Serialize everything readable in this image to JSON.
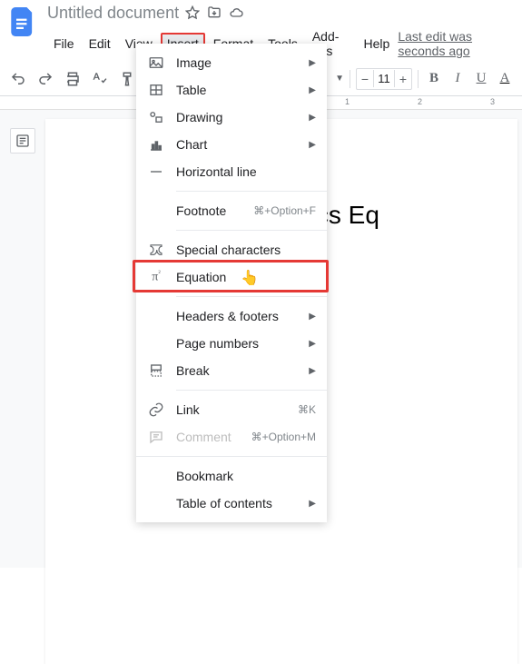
{
  "header": {
    "doc_title": "Untitled document",
    "last_edit": "Last edit was seconds ago"
  },
  "menubar": {
    "items": [
      "File",
      "Edit",
      "View",
      "Insert",
      "Format",
      "Tools",
      "Add-ons",
      "Help"
    ],
    "active_index": 3
  },
  "toolbar": {
    "font_size": "11"
  },
  "ruler": {
    "marks": [
      "1",
      "2",
      "3"
    ]
  },
  "document": {
    "content": "Google Docs Eq"
  },
  "insert_menu": {
    "groups": [
      {
        "items": [
          {
            "icon": "image",
            "label": "Image",
            "submenu": true
          },
          {
            "icon": "table",
            "label": "Table",
            "submenu": true
          },
          {
            "icon": "drawing",
            "label": "Drawing",
            "submenu": true
          },
          {
            "icon": "chart",
            "label": "Chart",
            "submenu": true
          },
          {
            "icon": "hr",
            "label": "Horizontal line"
          }
        ]
      },
      {
        "items": [
          {
            "icon": "none",
            "label": "Footnote",
            "shortcut": "⌘+Option+F"
          }
        ]
      },
      {
        "items": [
          {
            "icon": "omega",
            "label": "Special characters"
          },
          {
            "icon": "pi",
            "label": "Equation",
            "highlighted": true
          }
        ]
      },
      {
        "items": [
          {
            "icon": "none",
            "label": "Headers & footers",
            "submenu": true
          },
          {
            "icon": "none",
            "label": "Page numbers",
            "submenu": true
          },
          {
            "icon": "break",
            "label": "Break",
            "submenu": true
          }
        ]
      },
      {
        "items": [
          {
            "icon": "link",
            "label": "Link",
            "shortcut": "⌘K"
          },
          {
            "icon": "comment",
            "label": "Comment",
            "shortcut": "⌘+Option+M",
            "disabled": true
          }
        ]
      },
      {
        "items": [
          {
            "icon": "none",
            "label": "Bookmark"
          },
          {
            "icon": "none",
            "label": "Table of contents",
            "submenu": true
          }
        ]
      }
    ]
  }
}
